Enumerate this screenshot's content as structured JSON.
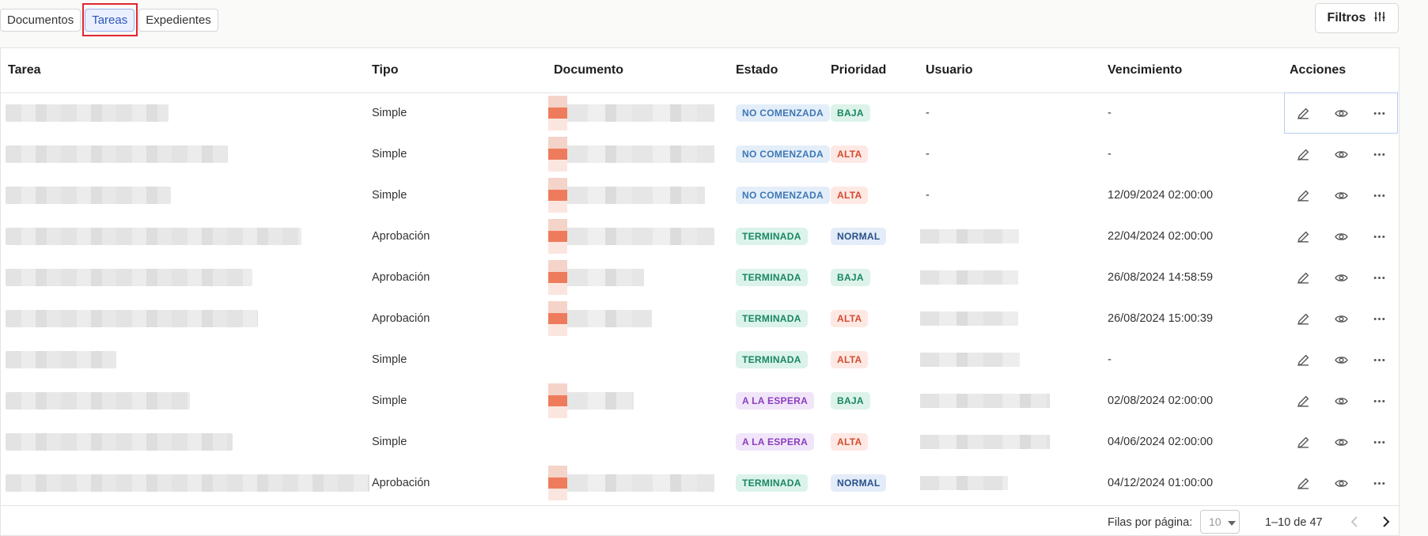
{
  "tabs": [
    {
      "label": "Documentos",
      "active": false
    },
    {
      "label": "Tareas",
      "active": true
    },
    {
      "label": "Expedientes",
      "active": false
    }
  ],
  "filters_label": "Filtros",
  "columns": [
    "Tarea",
    "Tipo",
    "Documento",
    "Estado",
    "Prioridad",
    "Usuario",
    "Vencimiento",
    "Acciones"
  ],
  "rows": [
    {
      "tipo": "Simple",
      "estado": "NO COMENZADA",
      "prioridad": "BAJA",
      "usuario": "-",
      "vencimiento": "-"
    },
    {
      "tipo": "Simple",
      "estado": "NO COMENZADA",
      "prioridad": "ALTA",
      "usuario": "-",
      "vencimiento": "-"
    },
    {
      "tipo": "Simple",
      "estado": "NO COMENZADA",
      "prioridad": "ALTA",
      "usuario": "-",
      "vencimiento": "12/09/2024 02:00:00"
    },
    {
      "tipo": "Aprobación",
      "estado": "TERMINADA",
      "prioridad": "NORMAL",
      "usuario": "",
      "vencimiento": "22/04/2024 02:00:00"
    },
    {
      "tipo": "Aprobación",
      "estado": "TERMINADA",
      "prioridad": "BAJA",
      "usuario": "",
      "vencimiento": "26/08/2024 14:58:59"
    },
    {
      "tipo": "Aprobación",
      "estado": "TERMINADA",
      "prioridad": "ALTA",
      "usuario": "",
      "vencimiento": "26/08/2024 15:00:39"
    },
    {
      "tipo": "Simple",
      "estado": "TERMINADA",
      "prioridad": "ALTA",
      "usuario": "",
      "vencimiento": "-"
    },
    {
      "tipo": "Simple",
      "estado": "A LA ESPERA",
      "prioridad": "BAJA",
      "usuario": "",
      "vencimiento": "02/08/2024 02:00:00"
    },
    {
      "tipo": "Simple",
      "estado": "A LA ESPERA",
      "prioridad": "ALTA",
      "usuario": "",
      "vencimiento": "04/06/2024 02:00:00"
    },
    {
      "tipo": "Aprobación",
      "estado": "TERMINADA",
      "prioridad": "NORMAL",
      "usuario": "",
      "vencimiento": "04/12/2024 01:00:00"
    }
  ],
  "action_icons": [
    "pencil-icon",
    "eye-icon",
    "more-horizontal-icon"
  ],
  "pagination": {
    "rows_per_page_label": "Filas por página:",
    "rows_per_page_value": "10",
    "range_text": "1–10 de 47"
  }
}
